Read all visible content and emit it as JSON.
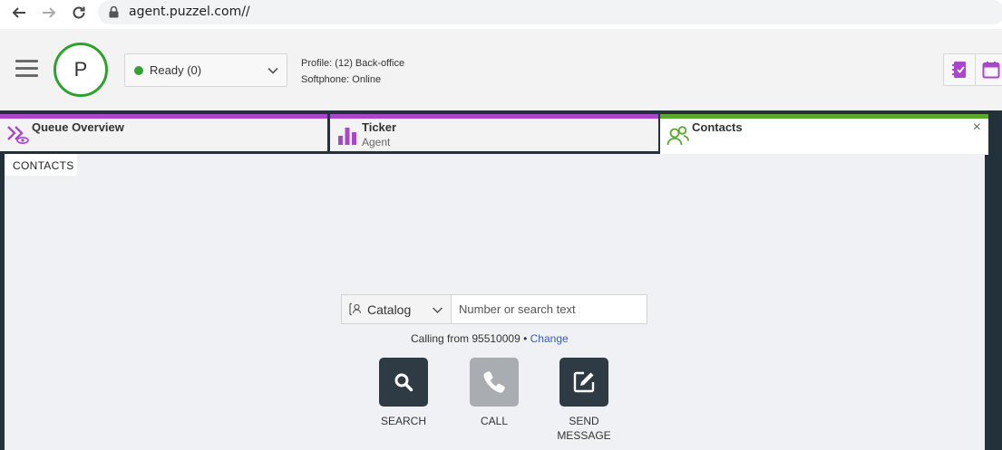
{
  "browser": {
    "url": "agent.puzzel.com//",
    "icons": [
      "back-icon",
      "forward-icon",
      "reload-icon",
      "lock-icon"
    ]
  },
  "header": {
    "avatar_initial": "P",
    "status": {
      "label": "Ready (0)",
      "color": "#35a135"
    },
    "profile_text": "Profile: (12) Back-office",
    "softphone_text": "Softphone: Online",
    "quick_icons": [
      "notebook-icon",
      "calendar-icon"
    ]
  },
  "tabs": [
    {
      "title": "Queue Overview",
      "subtitle": "",
      "icon": "queue-overview-icon",
      "accent": "#a848c8"
    },
    {
      "title": "Ticker",
      "subtitle": "Agent",
      "icon": "bar-chart-icon",
      "accent": "#a848c8"
    },
    {
      "title": "Contacts",
      "subtitle": "",
      "icon": "contacts-icon",
      "accent": "#5aa832",
      "active": true,
      "close": "×"
    }
  ],
  "contacts": {
    "section_label": "CONTACTS",
    "catalog_label": "Catalog",
    "search_placeholder": "Number or search text",
    "calling_from_text": "Calling from 95510009",
    "change_label": "Change",
    "actions": [
      {
        "label": "SEARCH",
        "icon": "search-icon",
        "enabled": true
      },
      {
        "label": "CALL",
        "icon": "phone-icon",
        "enabled": false
      },
      {
        "label": "SEND\nMESSAGE",
        "icon": "edit-icon",
        "enabled": true
      }
    ]
  }
}
